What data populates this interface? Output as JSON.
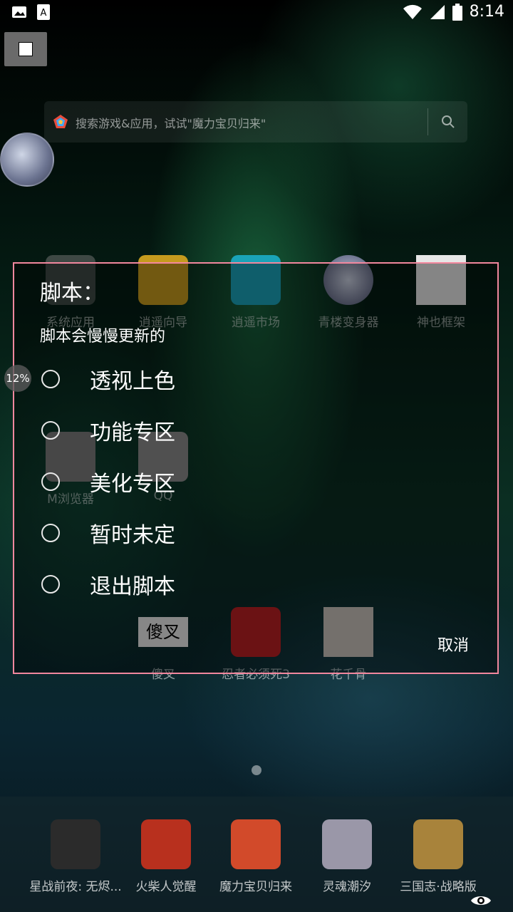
{
  "status": {
    "time": "8:14"
  },
  "search": {
    "placeholder": "搜索游戏&应用，试试\"魔力宝贝归来\""
  },
  "apps_row1": [
    {
      "label": "系统应用"
    },
    {
      "label": "逍遥向导"
    },
    {
      "label": "逍遥市场"
    },
    {
      "label": "青楼变身器"
    },
    {
      "label": "神也框架"
    }
  ],
  "apps_row2": [
    {
      "label": "M浏览器"
    },
    {
      "label": "QQ"
    }
  ],
  "apps_row3": [
    {
      "label": "傻叉",
      "icon_text": "傻叉"
    },
    {
      "label": "忍者必须死3"
    },
    {
      "label": "花千骨"
    }
  ],
  "dock": [
    {
      "label": "星战前夜: 无烬..."
    },
    {
      "label": "火柴人觉醒"
    },
    {
      "label": "魔力宝贝归来"
    },
    {
      "label": "灵魂潮汐"
    },
    {
      "label": "三国志·战略版"
    }
  ],
  "floating": {
    "progress": "12%"
  },
  "dialog": {
    "title": "脚本：",
    "subtitle": "脚本会慢慢更新的",
    "options": [
      "透视上色",
      "功能专区",
      "美化专区",
      "暂时未定",
      "退出脚本"
    ],
    "cancel": "取消"
  }
}
